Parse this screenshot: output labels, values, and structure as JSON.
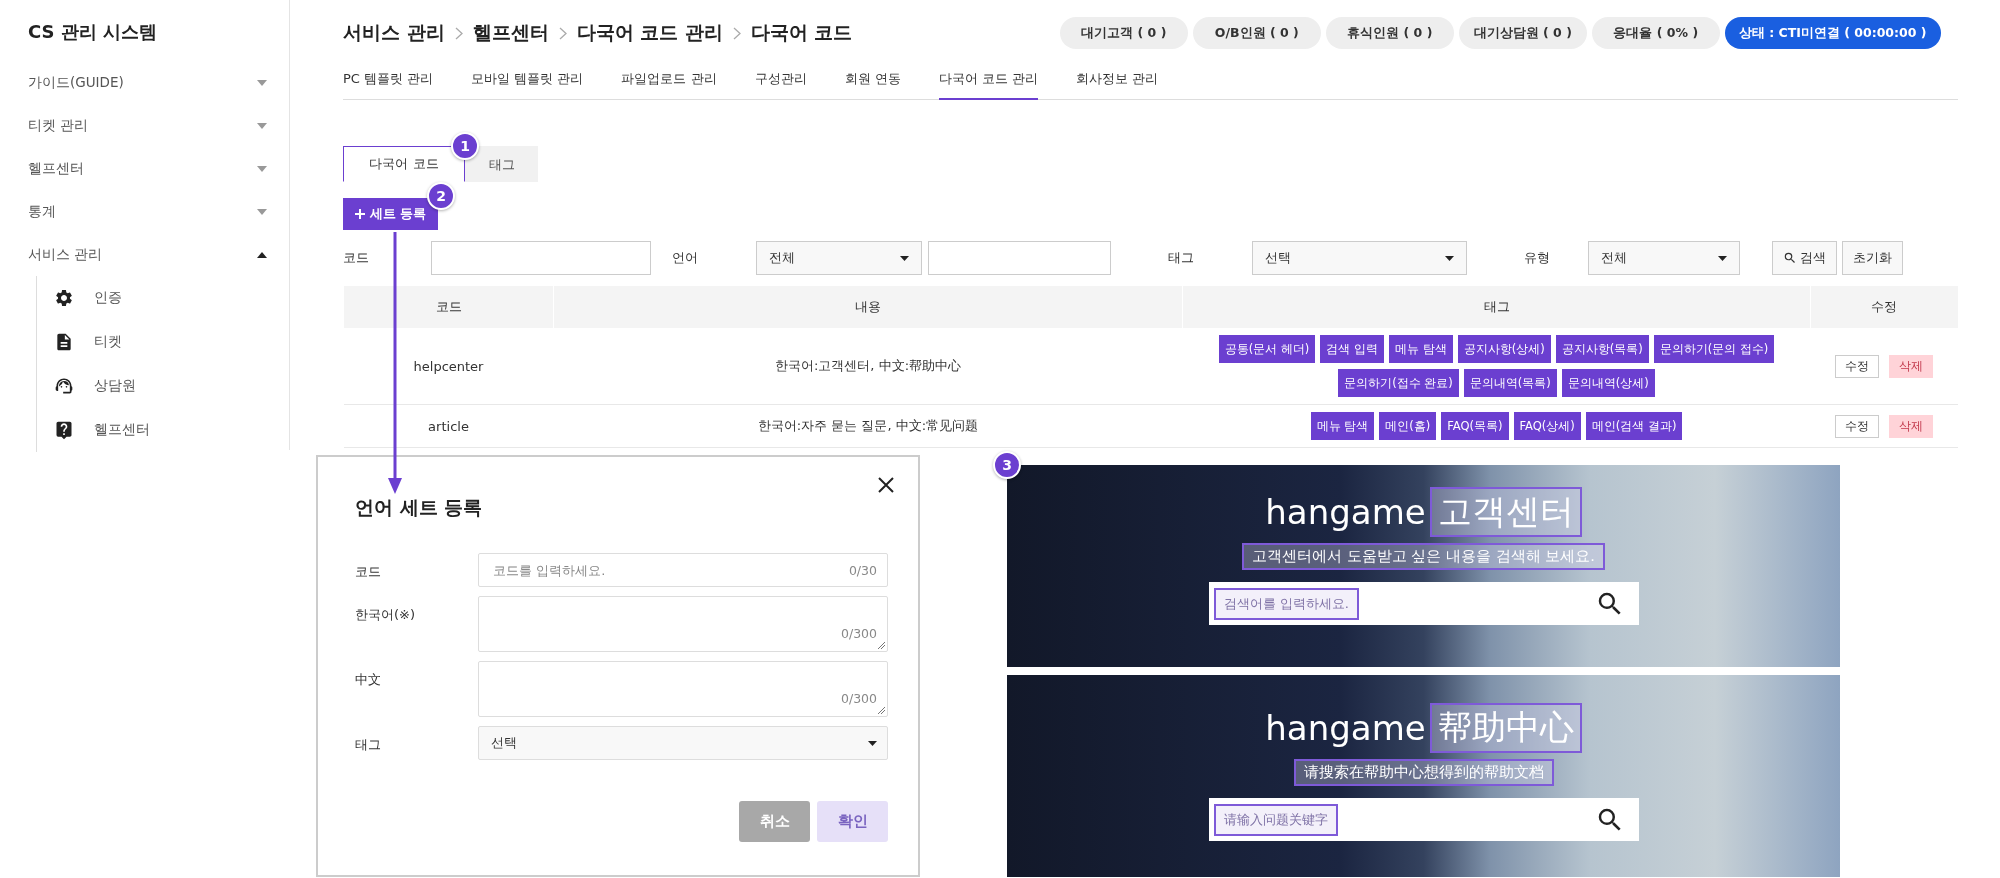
{
  "sidebar": {
    "title": "CS 관리 시스템",
    "items": [
      {
        "label": "가이드(GUIDE)",
        "expanded": false
      },
      {
        "label": "티켓 관리",
        "expanded": false
      },
      {
        "label": "헬프센터",
        "expanded": false
      },
      {
        "label": "통계",
        "expanded": false
      },
      {
        "label": "서비스 관리",
        "expanded": true,
        "children": [
          {
            "label": "인증"
          },
          {
            "label": "티켓"
          },
          {
            "label": "상담원"
          },
          {
            "label": "헬프센터"
          }
        ]
      }
    ]
  },
  "breadcrumb": [
    "서비스 관리",
    "헬프센터",
    "다국어 코드 관리",
    "다국어 코드"
  ],
  "status_pills": [
    {
      "label": "대기고객 ( 0 )",
      "kind": "counter"
    },
    {
      "label": "O/B인원 ( 0 )",
      "kind": "counter"
    },
    {
      "label": "휴식인원 ( 0 )",
      "kind": "counter"
    },
    {
      "label": "대기상담원 ( 0 )",
      "kind": "counter"
    },
    {
      "label": "응대율 ( 0% )",
      "kind": "counter"
    },
    {
      "label": "상태 : CTI미연결 ( 00:00:00 )",
      "kind": "status"
    }
  ],
  "menu_tabs": [
    {
      "label": "PC 템플릿 관리",
      "selected": false
    },
    {
      "label": "모바일 템플릿 관리",
      "selected": false
    },
    {
      "label": "파일업로드 관리",
      "selected": false
    },
    {
      "label": "구성관리",
      "selected": false
    },
    {
      "label": "회원 연동",
      "selected": false
    },
    {
      "label": "다국어 코드 관리",
      "selected": true
    },
    {
      "label": "회사정보 관리",
      "selected": false
    }
  ],
  "inner_tabs": [
    {
      "label": "다국어 코드",
      "selected": true
    },
    {
      "label": "태그",
      "selected": false
    }
  ],
  "callouts": [
    "1",
    "2",
    "3"
  ],
  "register_button": "세트 등록",
  "filters": [
    {
      "label": "코드",
      "controls": [
        {
          "kind": "text"
        }
      ]
    },
    {
      "label": "언어",
      "controls": [
        {
          "kind": "select",
          "value": "전체"
        },
        {
          "kind": "text"
        }
      ]
    },
    {
      "label": "태그",
      "controls": [
        {
          "kind": "select",
          "value": "선택"
        }
      ]
    },
    {
      "label": "유형",
      "controls": [
        {
          "kind": "select",
          "value": "전체"
        }
      ]
    }
  ],
  "filter_buttons": [
    {
      "label": "검색",
      "kind": "search"
    },
    {
      "label": "초기화",
      "kind": "reset"
    }
  ],
  "table": {
    "columns": [
      "코드",
      "내용",
      "태그",
      "수정"
    ],
    "rows": [
      {
        "code": "helpcenter",
        "content": "한국어:고객센터, 中文:帮助中心",
        "tags": [
          "공통(문서 헤더)",
          "검색 입력",
          "메뉴 탐색",
          "공지사항(상세)",
          "공지사항(목록)",
          "문의하기(문의 접수)",
          "문의하기(접수 완료)",
          "문의내역(목록)",
          "문의내역(상세)"
        ],
        "actions": [
          {
            "label": "수정",
            "disabled": false
          },
          {
            "label": "삭제",
            "disabled": true
          }
        ]
      },
      {
        "code": "article",
        "content": "한국어:자주 묻는 질문, 中文:常见问题",
        "tags": [
          "메뉴 탐색",
          "메인(홈)",
          "FAQ(목록)",
          "FAQ(상세)",
          "메인(검색 결과)"
        ],
        "actions": [
          {
            "label": "수정",
            "disabled": false
          },
          {
            "label": "삭제",
            "disabled": true
          }
        ]
      }
    ]
  },
  "modal": {
    "title": "언어 세트 등록",
    "fields": [
      {
        "label": "코드",
        "kind": "input",
        "placeholder": "코드를 입력하세요.",
        "counter": "0/30"
      },
      {
        "label": "한국어(※)",
        "kind": "textarea",
        "counter": "0/300"
      },
      {
        "label": "中文",
        "kind": "textarea",
        "counter": "0/300"
      },
      {
        "label": "태그",
        "kind": "select",
        "value": "선택"
      }
    ],
    "buttons": [
      {
        "label": "취소",
        "disabled": false
      },
      {
        "label": "확인",
        "disabled": true
      }
    ]
  },
  "banners": [
    {
      "brand": "hangame",
      "title": "고객센터",
      "subtitle": "고객센터에서 도움받고 싶은 내용을 검색해 보세요.",
      "placeholder": "검색어를 입력하세요."
    },
    {
      "brand": "hangame",
      "title": "帮助中心",
      "subtitle": "请搜索在帮助中心想得到的帮助文档",
      "placeholder": "请输入问题关键字"
    }
  ]
}
